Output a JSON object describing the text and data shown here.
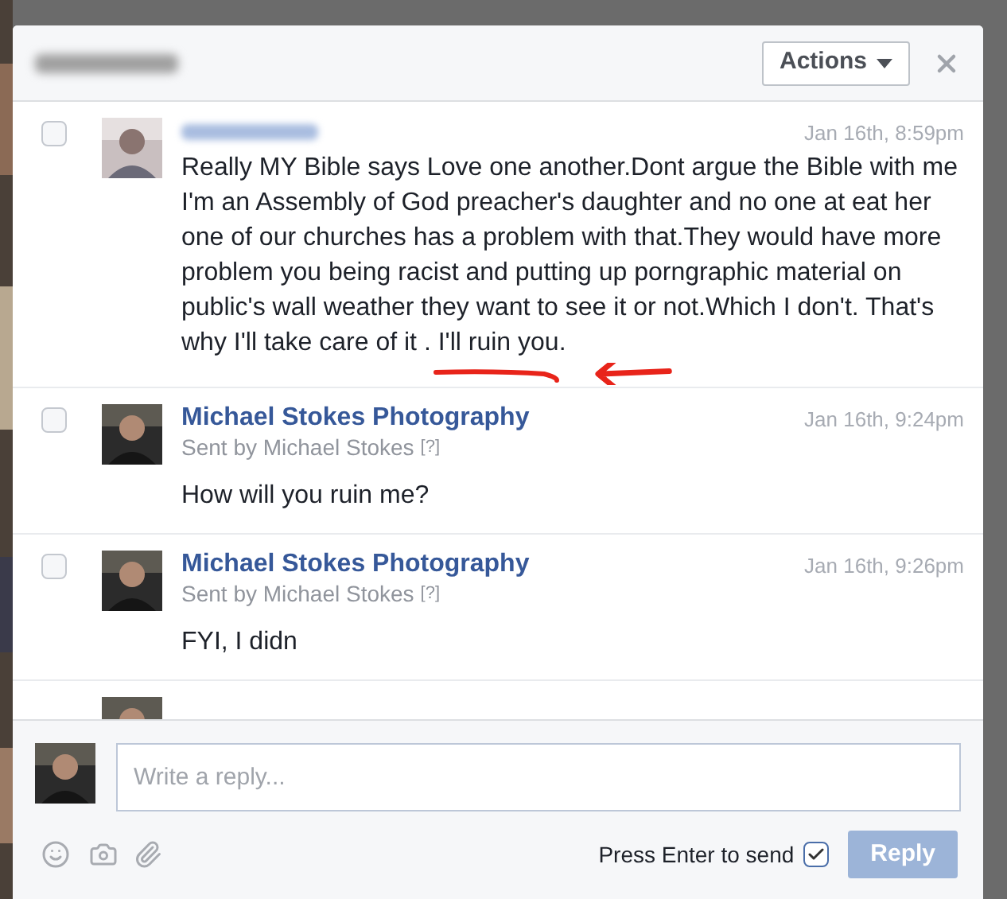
{
  "dialog": {
    "actions_button": "Actions"
  },
  "messages": [
    {
      "checked": false,
      "time": "Jan 16th, 8:59pm",
      "body": "Really MY Bible says Love one another.Dont argue the Bible with me I'm an Assembly of God preacher's daughter and no one at eat her one of our churches has a problem with that.They would have more problem you being racist and putting up porngraphic material on public's wall weather they want to see it or not.Which I don't. That's why I'll take care of it . I'll ruin you.",
      "annotated": true
    },
    {
      "checked": false,
      "sender": "Michael Stokes Photography",
      "sent_by": "Sent by Michael Stokes",
      "help": "[?]",
      "time": "Jan 16th, 9:24pm",
      "body": "How will you ruin me?"
    },
    {
      "checked": false,
      "sender": "Michael Stokes Photography",
      "sent_by": "Sent by Michael Stokes",
      "help": "[?]",
      "time": "Jan 16th, 9:26pm",
      "body": "FYI, I didn"
    }
  ],
  "composer": {
    "placeholder": "Write a reply...",
    "enter_to_send": {
      "label": "Press Enter to send",
      "checked": true
    },
    "reply_button": {
      "label": "Reply",
      "disabled": true
    }
  }
}
